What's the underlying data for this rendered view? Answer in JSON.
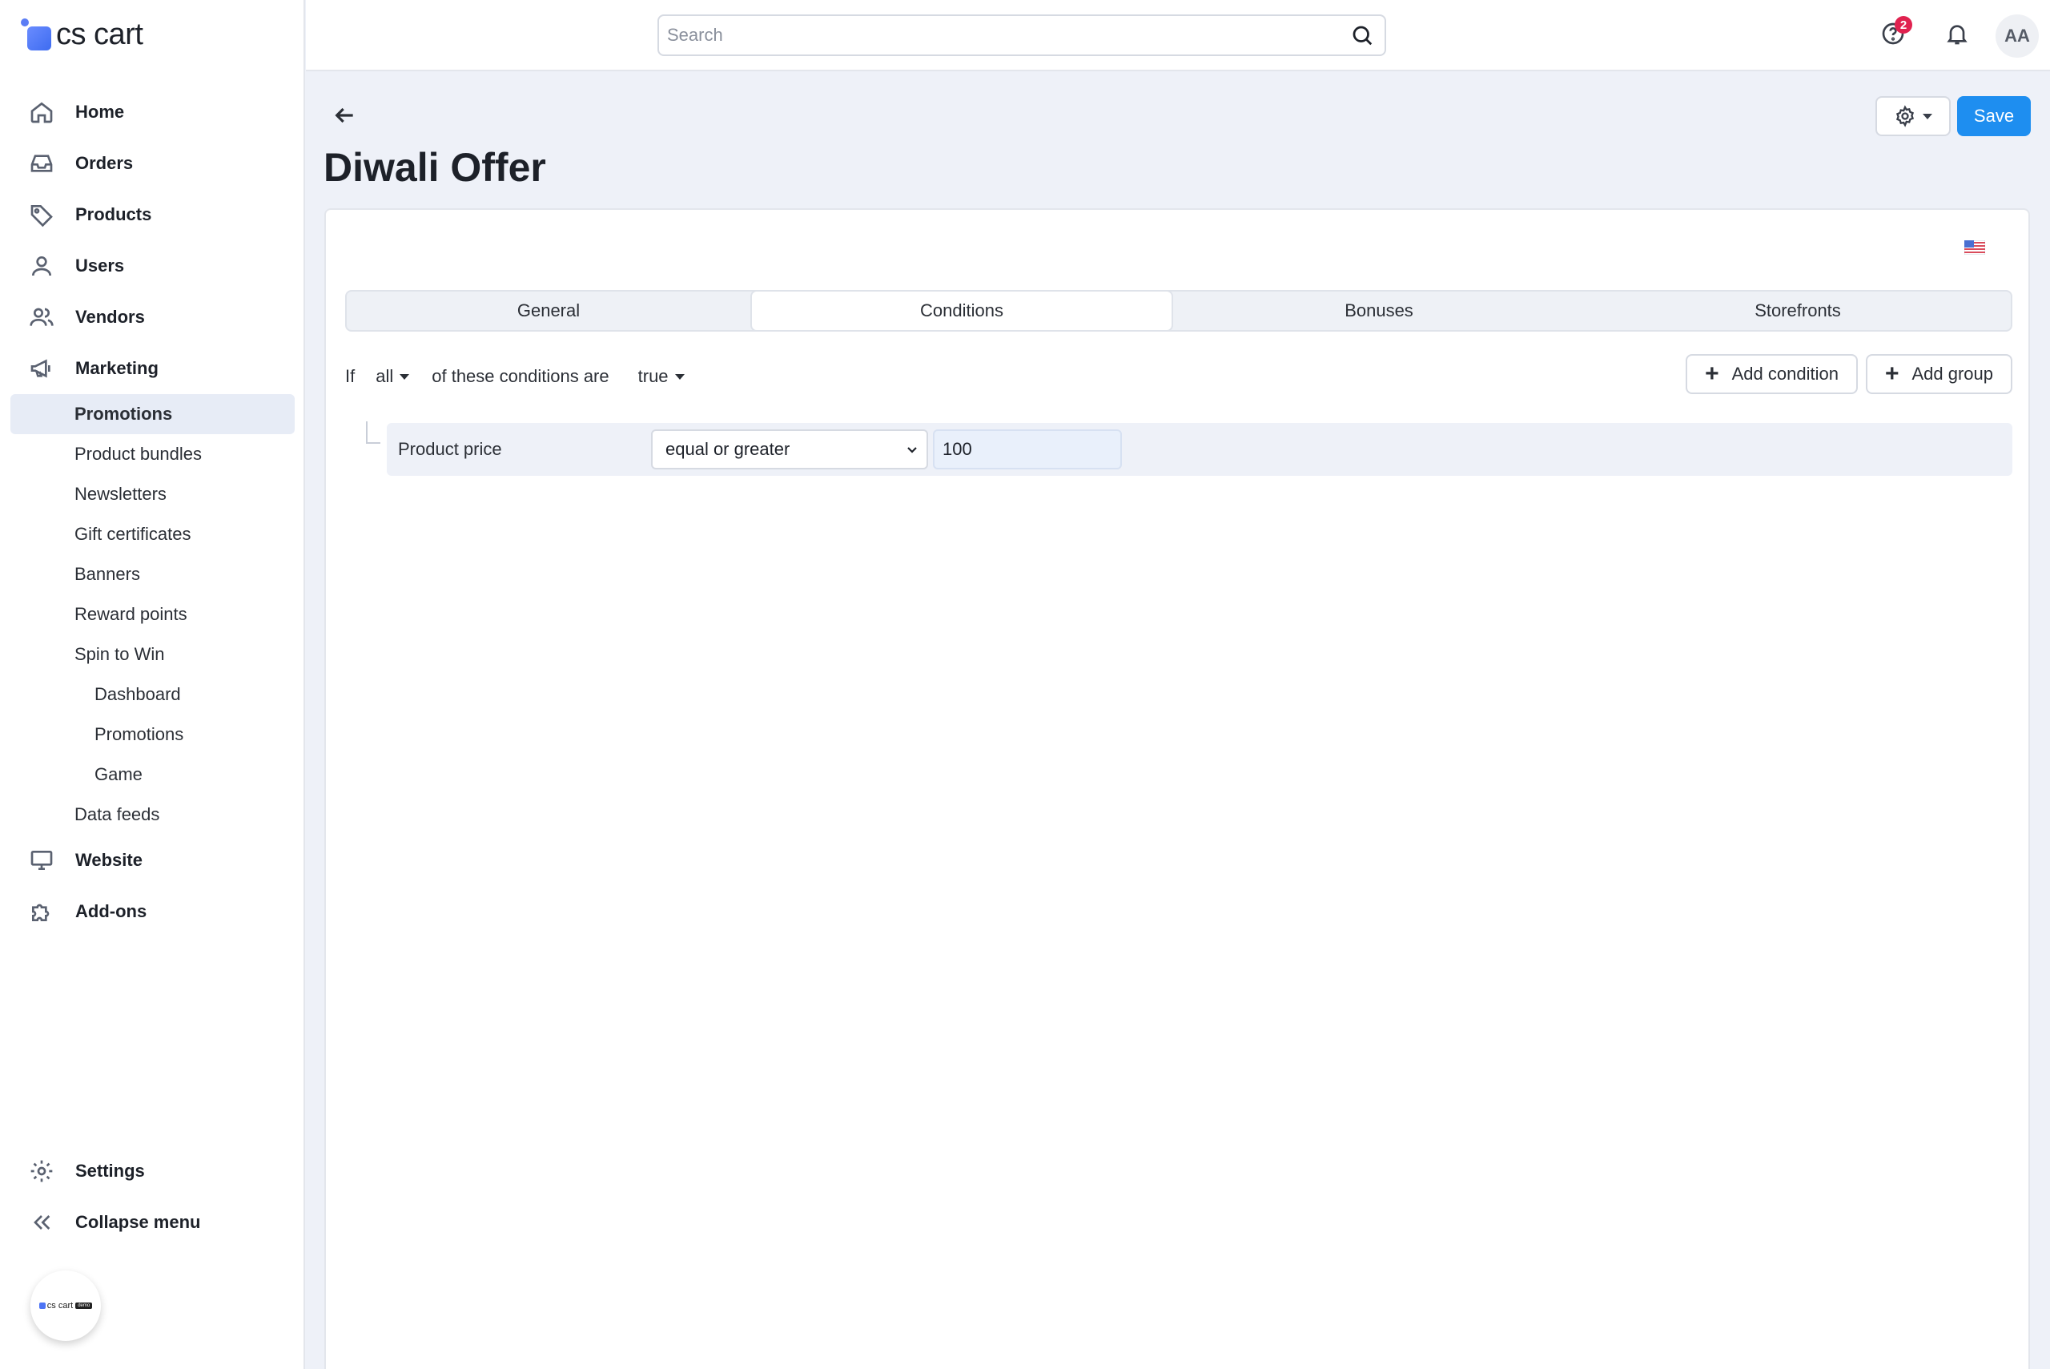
{
  "app": {
    "logo_text": "cs cart",
    "mini_badge_text": "cs cart",
    "mini_badge_tag": "demo"
  },
  "search": {
    "placeholder": "Search"
  },
  "topbar": {
    "help_badge_count": "2",
    "avatar_initials": "AA"
  },
  "sidebar": {
    "items": [
      {
        "label": "Home",
        "icon": "home-icon"
      },
      {
        "label": "Orders",
        "icon": "inbox-icon"
      },
      {
        "label": "Products",
        "icon": "tag-icon"
      },
      {
        "label": "Users",
        "icon": "user-icon"
      },
      {
        "label": "Vendors",
        "icon": "users-icon"
      },
      {
        "label": "Marketing",
        "icon": "megaphone-icon"
      }
    ],
    "marketing_sub": [
      {
        "label": "Promotions",
        "active": true
      },
      {
        "label": "Product bundles"
      },
      {
        "label": "Newsletters"
      },
      {
        "label": "Gift certificates"
      },
      {
        "label": "Banners"
      },
      {
        "label": "Reward points"
      },
      {
        "label": "Spin to Win"
      }
    ],
    "spin_sub": [
      {
        "label": "Dashboard"
      },
      {
        "label": "Promotions"
      },
      {
        "label": "Game"
      }
    ],
    "after_sub": [
      {
        "label": "Data feeds"
      }
    ],
    "more_items": [
      {
        "label": "Website",
        "icon": "monitor-icon"
      },
      {
        "label": "Add-ons",
        "icon": "puzzle-icon"
      }
    ],
    "bottom": [
      {
        "label": "Settings",
        "icon": "gear-icon"
      },
      {
        "label": "Collapse menu",
        "icon": "double-chevron-left-icon"
      }
    ]
  },
  "page": {
    "title": "Diwali Offer",
    "save_label": "Save",
    "tabs": [
      "General",
      "Conditions",
      "Bonuses",
      "Storefronts"
    ],
    "active_tab": "Conditions"
  },
  "conditions": {
    "if_label": "If",
    "match_value": "all",
    "middle_text": "of these conditions are",
    "truth_value": "true",
    "add_condition_label": "Add condition",
    "add_group_label": "Add group",
    "rows": [
      {
        "label": "Product price",
        "operator": "equal or greater",
        "value": "100"
      }
    ]
  },
  "colors": {
    "accent": "#1e8ef0",
    "badge": "#e0224f",
    "active_nav_bg": "#e7ecf6"
  }
}
